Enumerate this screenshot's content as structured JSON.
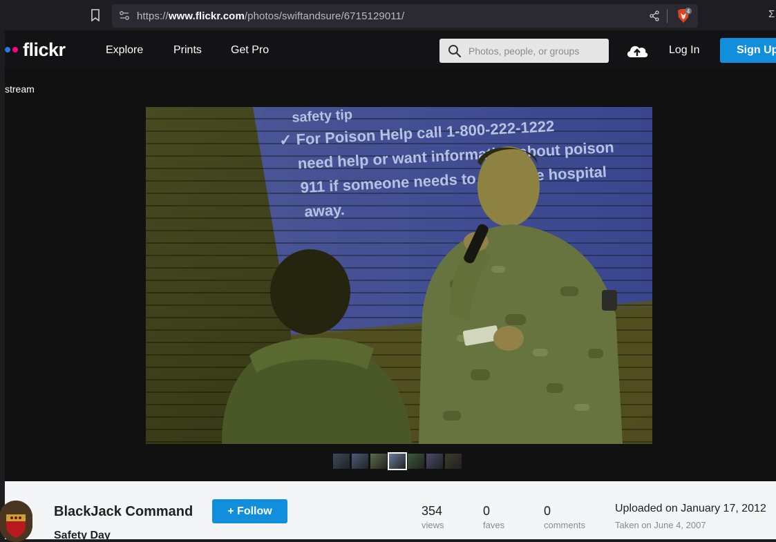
{
  "browser": {
    "url_prefix": "https://",
    "url_domain": "www.flickr.com",
    "url_path": "/photos/swiftandsure/6715129011/",
    "shields_count": "4",
    "extension_glyph": "Σ"
  },
  "nav": {
    "logo": "flickr",
    "links": [
      "Explore",
      "Prints",
      "Get Pro"
    ],
    "search_placeholder": "Photos, people, or groups",
    "login": "Log In",
    "signup": "Sign Up"
  },
  "photo_page": {
    "back_link": "stream",
    "slide_text": [
      "safety tip",
      "✓ For Poison Help call 1-800-222-1222",
      "need help or want information about poison",
      "911 if someone needs to go to the hospital",
      "away."
    ],
    "thumb_count": 7,
    "active_thumb": 3
  },
  "info": {
    "owner": "BlackJack Command",
    "follow": "+ Follow",
    "title": "Safety Day",
    "views_count": "354",
    "views_label": "views",
    "faves_count": "0",
    "faves_label": "faves",
    "comments_count": "0",
    "comments_label": "comments",
    "uploaded": "Uploaded on January 17, 2012",
    "taken": "Taken on June 4, 2007"
  },
  "colors": {
    "accent": "#128fdc",
    "flickr_blue": "#1f7ee2",
    "flickr_pink": "#ff0084"
  }
}
